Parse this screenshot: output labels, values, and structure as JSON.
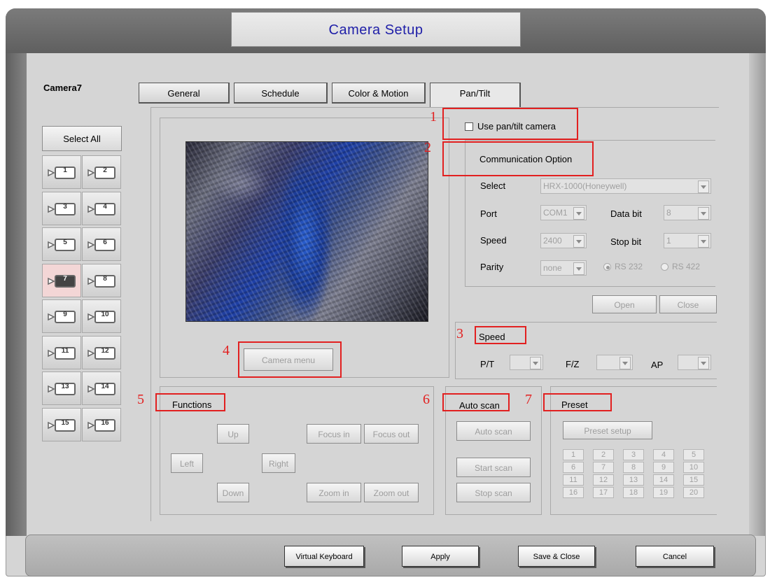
{
  "window": {
    "title": "Camera Setup"
  },
  "camera_name": "Camera7",
  "tabs": [
    {
      "label": "General"
    },
    {
      "label": "Schedule"
    },
    {
      "label": "Color & Motion"
    },
    {
      "label": "Pan/Tilt"
    }
  ],
  "sidebar": {
    "select_all": "Select All",
    "cameras": [
      "1",
      "2",
      "3",
      "4",
      "5",
      "6",
      "7",
      "8",
      "9",
      "10",
      "11",
      "12",
      "13",
      "14",
      "15",
      "16"
    ],
    "selected": "7"
  },
  "preview": {
    "camera_menu": "Camera menu"
  },
  "pan_tilt": {
    "use_label": "Use pan/tilt camera",
    "use_checked": false,
    "comm_title": "Communication Option",
    "select_label": "Select",
    "select_value": "HRX-1000(Honeywell)",
    "port_label": "Port",
    "port_value": "COM1",
    "databit_label": "Data bit",
    "databit_value": "8",
    "speed_label": "Speed",
    "speed_value": "2400",
    "stopbit_label": "Stop bit",
    "stopbit_value": "1",
    "parity_label": "Parity",
    "parity_value": "none",
    "rs232": "RS 232",
    "rs422": "RS 422",
    "open": "Open",
    "close": "Close"
  },
  "speed": {
    "title": "Speed",
    "pt": "P/T",
    "fz": "F/Z",
    "ap": "AP"
  },
  "functions": {
    "title": "Functions",
    "up": "Up",
    "down": "Down",
    "left": "Left",
    "right": "Right",
    "focus_in": "Focus in",
    "focus_out": "Focus out",
    "zoom_in": "Zoom in",
    "zoom_out": "Zoom out"
  },
  "autoscan": {
    "title": "Auto scan",
    "auto": "Auto scan",
    "start": "Start scan",
    "stop": "Stop scan"
  },
  "preset": {
    "title": "Preset",
    "setup": "Preset setup",
    "numbers": [
      "1",
      "2",
      "3",
      "4",
      "5",
      "6",
      "7",
      "8",
      "9",
      "10",
      "11",
      "12",
      "13",
      "14",
      "15",
      "16",
      "17",
      "18",
      "19",
      "20"
    ]
  },
  "annotations": {
    "n1": "1",
    "n2": "2",
    "n3": "3",
    "n4": "4",
    "n5": "5",
    "n6": "6",
    "n7": "7"
  },
  "footer": {
    "virtual_keyboard": "Virtual Keyboard",
    "apply": "Apply",
    "save_close": "Save & Close",
    "cancel": "Cancel"
  },
  "colors": {
    "title_text": "#1f1fa8",
    "annotation": "#e22020"
  }
}
